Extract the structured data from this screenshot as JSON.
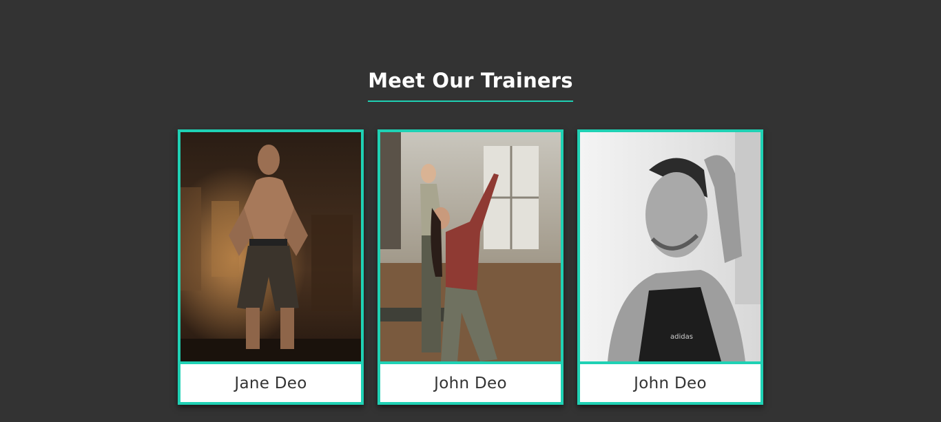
{
  "section": {
    "title": "Meet Our Trainers"
  },
  "accent_color": "#1fd1b4",
  "background_color": "#333333",
  "trainers": [
    {
      "name": "Jane Deo",
      "photo": "trainer-flexing-photo"
    },
    {
      "name": "John Deo",
      "photo": "trainer-yoga-stretch-photo"
    },
    {
      "name": "John Deo",
      "photo": "trainer-smiling-bw-photo"
    }
  ]
}
